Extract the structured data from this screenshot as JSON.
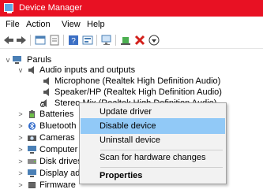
{
  "window": {
    "title": "Device Manager"
  },
  "menubar": [
    "File",
    "Action",
    "View",
    "Help"
  ],
  "toolbar": {
    "buttons": [
      "back-icon",
      "forward-icon",
      "properties-icon",
      "show-hidden-icon",
      "help-icon",
      "update-icon",
      "scan-icon",
      "enable-icon",
      "uninstall-icon",
      "download-icon"
    ]
  },
  "tree": {
    "root": "Paruls",
    "audio_category": "Audio inputs and outputs",
    "audio_devices": [
      "Microphone (Realtek High Definition Audio)",
      "Speaker/HP (Realtek High Definition Audio)",
      "Stereo Mix (Realtek High Definition Audio)"
    ],
    "categories": [
      "Batteries",
      "Bluetooth",
      "Cameras",
      "Computer",
      "Disk drives",
      "Display adapters",
      "Firmware"
    ]
  },
  "context_menu": {
    "items": [
      "Update driver",
      "Disable device",
      "Uninstall device",
      "Scan for hardware changes",
      "Properties"
    ],
    "highlighted": "Disable device"
  },
  "colors": {
    "titlebar": "#e81123",
    "highlight": "#91c9f7"
  }
}
